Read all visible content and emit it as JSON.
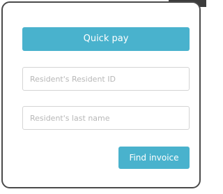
{
  "form": {
    "quick_pay_label": "Quick pay",
    "resident_id_placeholder": "Resident's Resident ID",
    "resident_id_value": "",
    "last_name_placeholder": "Resident's last name",
    "last_name_value": "",
    "find_invoice_label": "Find invoice"
  },
  "colors": {
    "accent": "#49b2cd",
    "border": "#4a4a4a",
    "input_border": "#d4d4d4",
    "placeholder": "#b7b7b7"
  }
}
